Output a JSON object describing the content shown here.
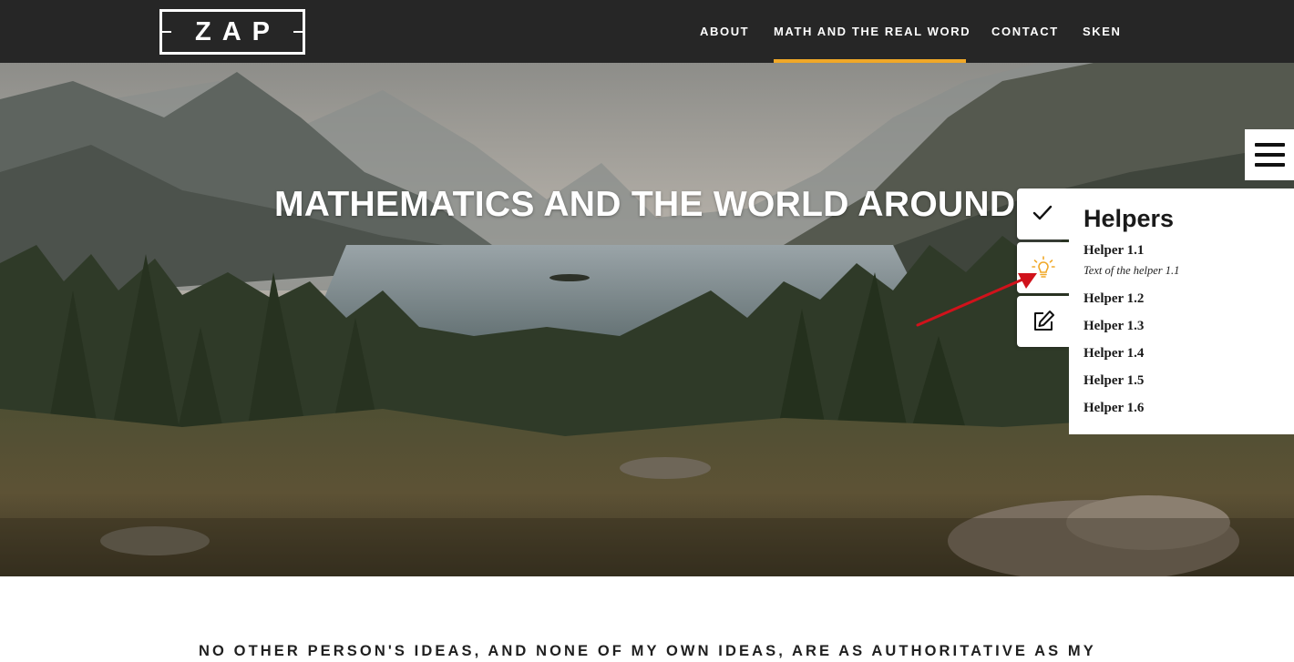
{
  "brand": {
    "logo_text": "ZAP"
  },
  "nav": {
    "items": [
      {
        "label": "ABOUT",
        "active": false
      },
      {
        "label": "MATH AND THE REAL WORD",
        "active": true
      },
      {
        "label": "CONTACT",
        "active": false
      },
      {
        "label": "SKEN",
        "active": false
      }
    ],
    "active_color": "#f0a828"
  },
  "hero": {
    "title": "MATHEMATICS AND THE WORLD AROUND US"
  },
  "tools": [
    {
      "icon": "check-icon"
    },
    {
      "icon": "lightbulb-icon",
      "color": "#f0a828"
    },
    {
      "icon": "edit-icon"
    }
  ],
  "helpers": {
    "title": "Helpers",
    "items": [
      {
        "label": "Helper 1.1",
        "text": "Text of the helper 1.1"
      },
      {
        "label": "Helper 1.2"
      },
      {
        "label": "Helper 1.3"
      },
      {
        "label": "Helper 1.4"
      },
      {
        "label": "Helper 1.5"
      },
      {
        "label": "Helper 1.6"
      }
    ]
  },
  "annotation": {
    "arrow_color": "#d0121b"
  },
  "content": {
    "quote_line": "NO OTHER PERSON'S IDEAS, AND NONE OF MY OWN IDEAS, ARE AS AUTHORITATIVE AS MY"
  }
}
